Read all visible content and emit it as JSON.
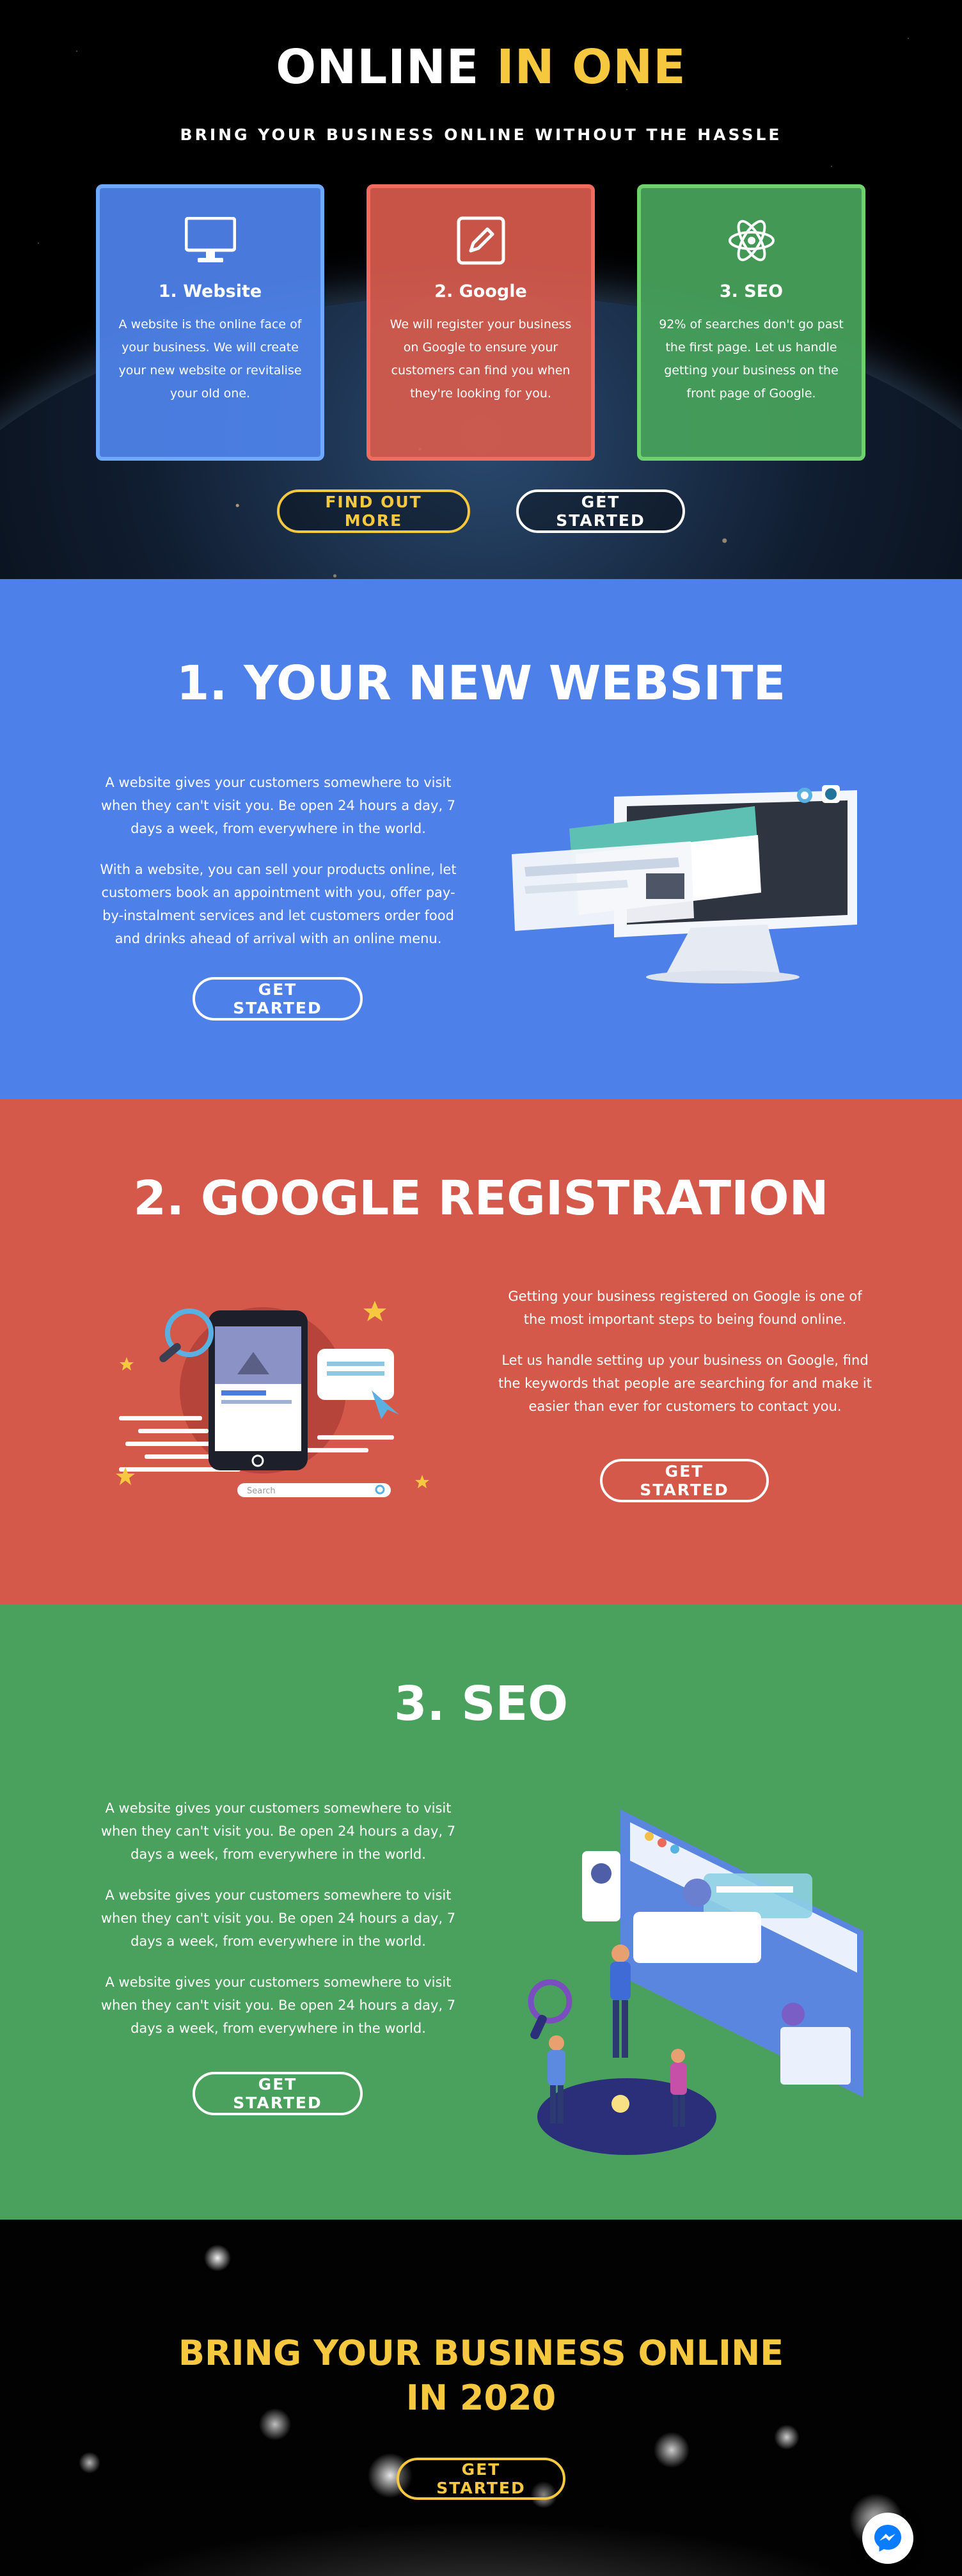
{
  "hero": {
    "title_white": "ONLINE",
    "title_accent": "IN ONE",
    "subtitle": "BRING YOUR BUSINESS ONLINE WITHOUT THE HASSLE",
    "cards": [
      {
        "title": "1. Website",
        "text": "A website is the online face of your business. We will create your new website or revitalise your old one.",
        "icon": "monitor-icon",
        "color": "#4f83ec"
      },
      {
        "title": "2. Google",
        "text": "We will register your business on Google to ensure your customers can find you when they're looking for you.",
        "icon": "edit-icon",
        "color": "#d65a4c"
      },
      {
        "title": "3. SEO",
        "text": "92% of searches don't go past the first page. Let us handle getting your business on the front page of Google.",
        "icon": "atom-icon",
        "color": "#47a05b"
      }
    ],
    "find_out_more": "FIND OUT MORE",
    "get_started": "GET STARTED"
  },
  "website": {
    "title": "1. YOUR NEW WEBSITE",
    "paragraphs": [
      "A website gives your customers somewhere to visit when they can't visit you. Be open 24 hours a day, 7 days a week, from everywhere in the world.",
      "With a website, you can sell your products online, let customers book an appointment with you, offer pay-by-instalment services and let customers order food and drinks ahead of arrival with an online menu."
    ],
    "button": "GET STARTED",
    "bg_color": "#4e80ea"
  },
  "google": {
    "title": "2. GOOGLE REGISTRATION",
    "paragraphs": [
      "Getting your business registered on Google is one of the most important steps to being found online.",
      "Let us handle setting up your business on Google, find the keywords that people are searching for and make it easier than ever for customers to contact you."
    ],
    "button": "GET STARTED",
    "search_placeholder": "Search",
    "bg_color": "#d4594a"
  },
  "seo": {
    "title": "3. SEO",
    "paragraphs": [
      "A website gives your customers somewhere to visit when they can't visit you. Be open 24 hours a day, 7 days a week, from everywhere in the world.",
      "A website gives your customers somewhere to visit when they can't visit you. Be open 24 hours a day, 7 days a week, from everywhere in the world.",
      "A website gives your customers somewhere to visit when they can't visit you. Be open 24 hours a day, 7 days a week, from everywhere in the world."
    ],
    "button": "GET STARTED",
    "bg_color": "#4aa05d"
  },
  "final": {
    "title_line1": "BRING YOUR BUSINESS ONLINE",
    "title_line2": "IN 2020",
    "button": "GET STARTED",
    "accent_color": "#f6c840"
  },
  "messenger": {
    "icon": "messenger-icon"
  }
}
